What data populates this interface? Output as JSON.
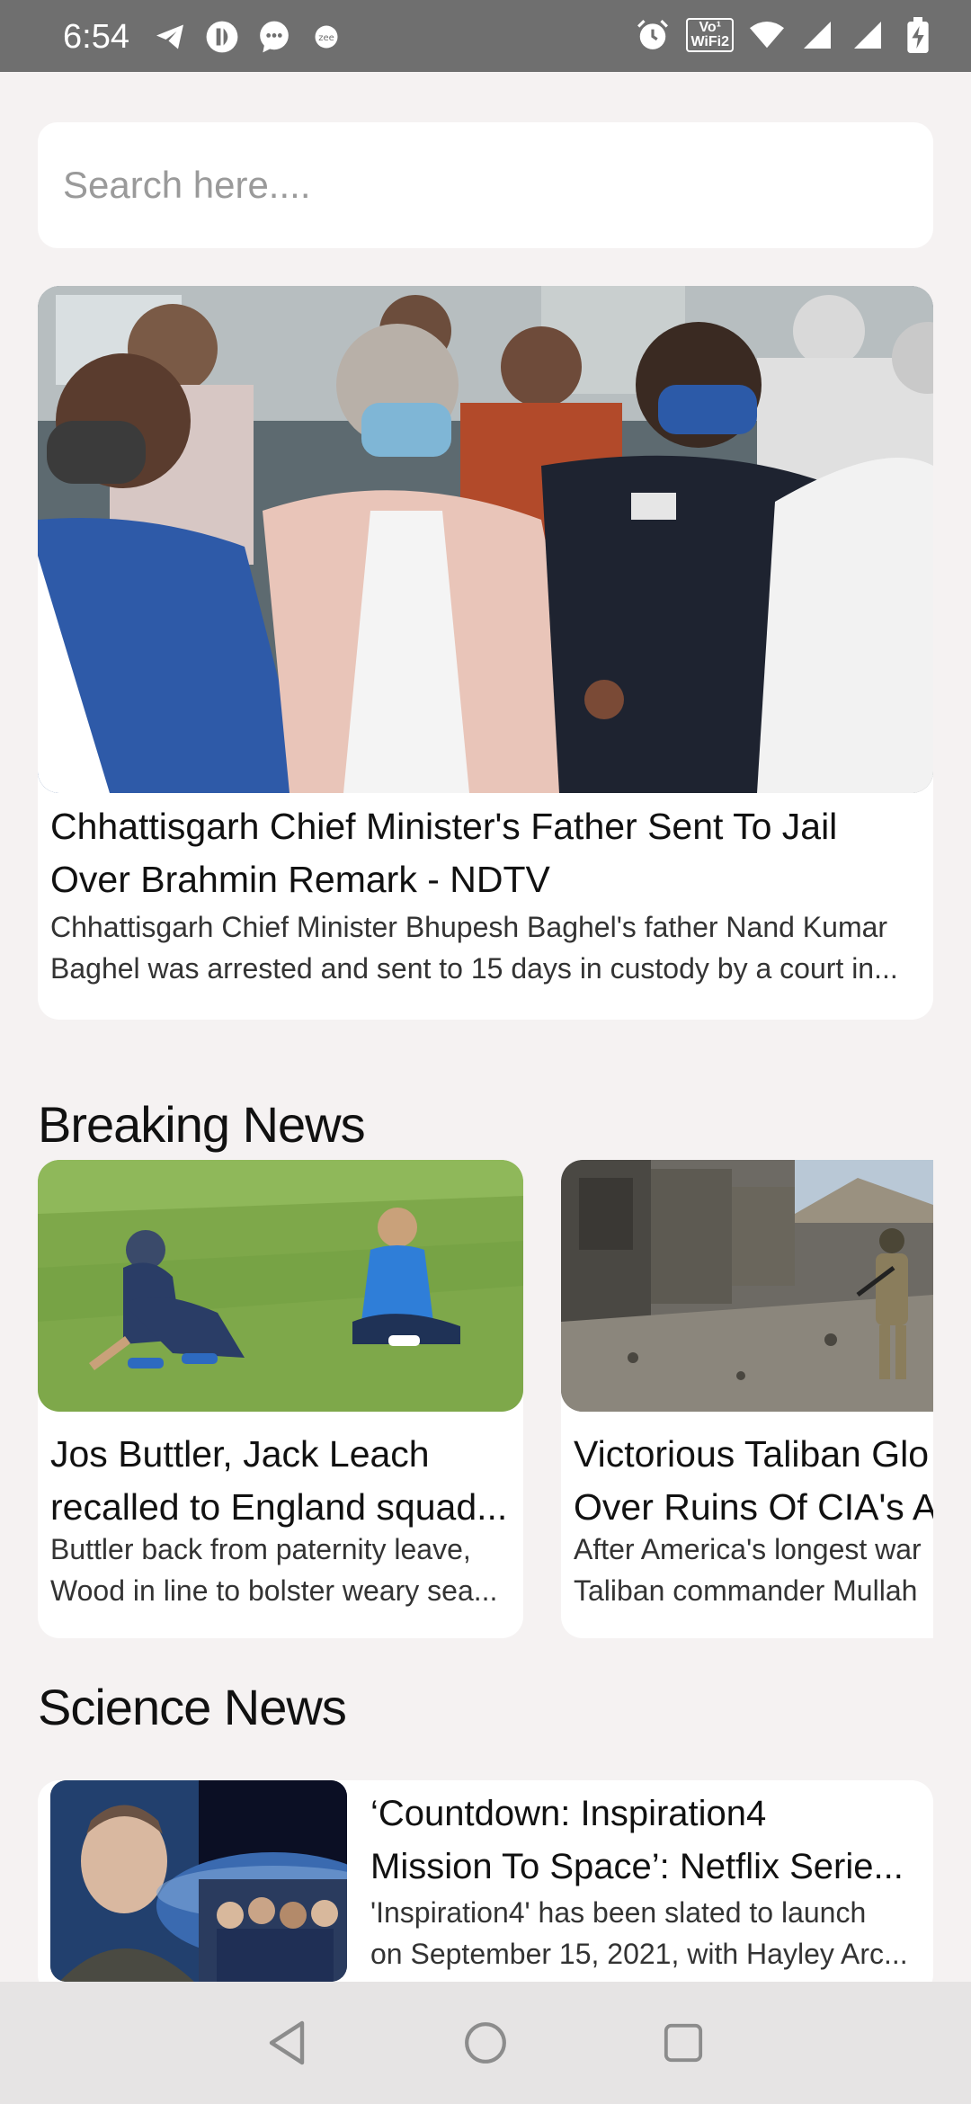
{
  "status_bar": {
    "time": "6:54",
    "wifi_badge_top": "Vo¹",
    "wifi_badge_bottom": "WiFi2",
    "left_icons": [
      "telegram-icon",
      "notification-app-icon",
      "messages-icon",
      "zee-icon"
    ],
    "right_icons": [
      "alarm-icon",
      "vowifi-icon",
      "wifi-icon",
      "signal-icon",
      "signal-icon",
      "battery-charging-icon"
    ]
  },
  "search": {
    "placeholder": "Search here....",
    "value": ""
  },
  "featured": {
    "title": "Chhattisgarh Chief Minister's Father Sent To Jail Over Brahmin Remark - NDTV",
    "description": "Chhattisgarh Chief Minister Bhupesh Baghel's father Nand Kumar Baghel was arrested and sent to 15 days in custody by a court in..."
  },
  "breaking_news": {
    "heading": "Breaking News",
    "items": [
      {
        "title_line1": "Jos Buttler, Jack Leach",
        "title_line2": "recalled to England squad...",
        "desc_line1": "Buttler back from paternity leave,",
        "desc_line2": "Wood in line to bolster weary sea..."
      },
      {
        "title_line1": "Victorious Taliban Glo",
        "title_line2": "Over Ruins Of CIA's A",
        "desc_line1": "After America's longest war",
        "desc_line2": "Taliban commander Mullah"
      }
    ]
  },
  "science_news": {
    "heading": "Science News",
    "items": [
      {
        "title_line1": "‘Countdown: Inspiration4",
        "title_line2": "Mission To Space’: Netflix Serie...",
        "desc_line1": "'Inspiration4' has been slated to launch",
        "desc_line2": "on September 15, 2021, with Hayley Arc..."
      }
    ]
  },
  "nav_bar": {
    "buttons": [
      "back-icon",
      "home-icon",
      "recents-icon"
    ]
  },
  "colors": {
    "status_bar_bg": "#6f6f6f",
    "page_bg": "#f5f2f2",
    "card_bg": "#ffffff",
    "nav_bar_bg": "#e6e4e4"
  }
}
